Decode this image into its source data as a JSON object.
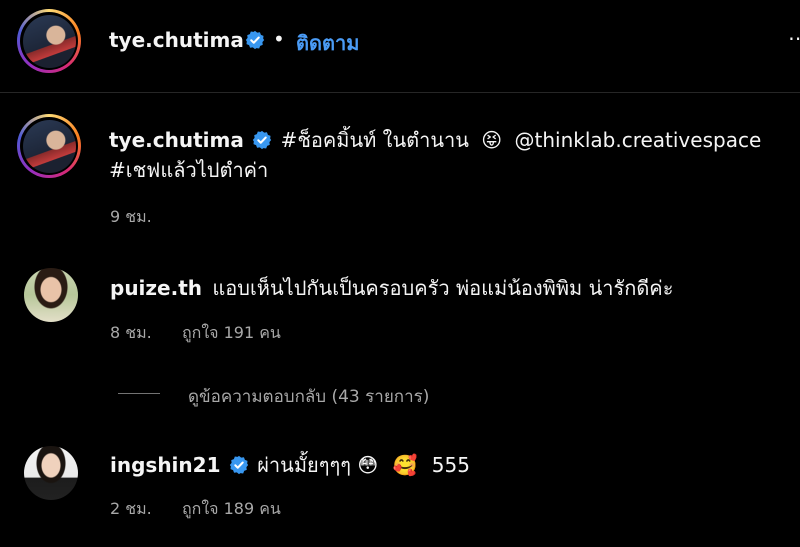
{
  "header": {
    "username": "tye.chutima",
    "separator": "•",
    "follow_label": "ติดตาม",
    "more_icon": "more-icon"
  },
  "caption": {
    "username": "tye.chutima",
    "line1": "#ช็อคมิ้นท์ ในตำนาน",
    "emoji": "😝",
    "mention": "@thinklab.creativespace",
    "line2": "#เชฟแล้วไปตำค่า",
    "time": "9 ชม."
  },
  "comments": [
    {
      "username": "puize.th",
      "verified": false,
      "text": "แอบเห็นไปกันเป็นครอบครัว พ่อแม่น้องพิพิม น่ารักดีค่ะ",
      "time": "8 ชม.",
      "likes": "ถูกใจ 191 คน",
      "replies_label": "ดูข้อความตอบกลับ (43 รายการ)"
    },
    {
      "username": "ingshin21",
      "verified": true,
      "text": "ผ่านมั้ยๆๆๆ",
      "emoji1": "😳",
      "emoji2": "🥰",
      "text2": "555",
      "time": "2 ชม.",
      "likes": "ถูกใจ 189 คน"
    }
  ],
  "colors": {
    "background": "#000000",
    "text": "#f5f5f5",
    "secondary": "#a8a8a8",
    "link": "#4a9bf5",
    "verified": "#3897f0"
  }
}
